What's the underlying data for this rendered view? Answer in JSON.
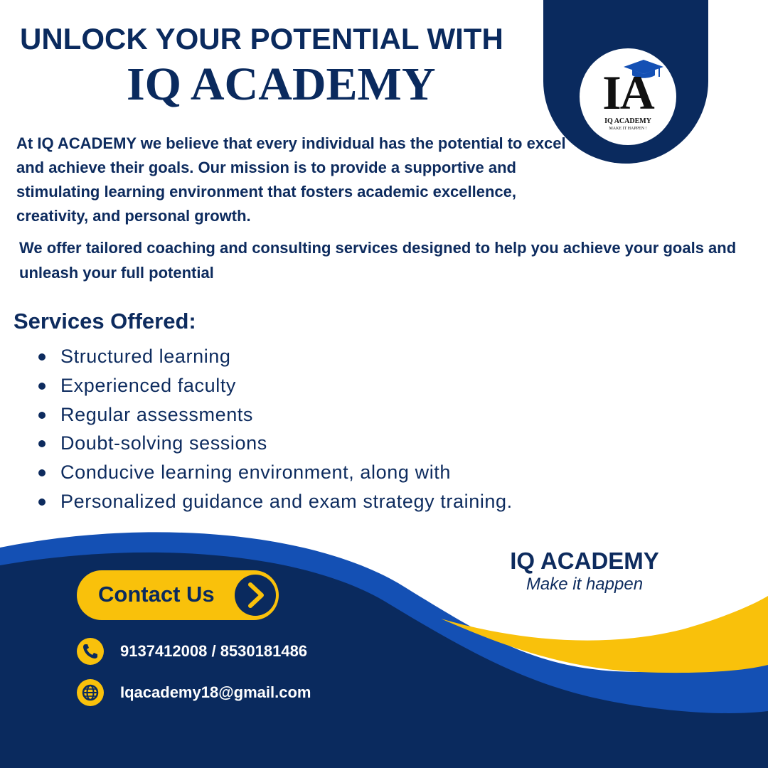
{
  "colors": {
    "navy": "#0a2a5e",
    "royal_blue": "#1450b4",
    "yellow": "#f9c10b",
    "white": "#ffffff"
  },
  "logo": {
    "monogram": "IA",
    "name": "IQ ACADEMY",
    "tagline": "MAKE IT HAPPEN !",
    "icon": "graduation-cap-icon"
  },
  "headline": {
    "line1": "UNLOCK YOUR POTENTIAL WITH",
    "line2": "IQ ACADEMY"
  },
  "intro": "At IQ ACADEMY we believe that every individual has the potential to excel and achieve their goals. Our mission is to provide a supportive and stimulating learning environment that fosters academic excellence, creativity, and personal growth.",
  "offer": "We offer tailored coaching and consulting services designed to help you achieve your goals and unleash your full potential",
  "services": {
    "heading": "Services Offered:",
    "items": [
      "Structured learning",
      "Experienced faculty",
      "Regular assessments",
      "Doubt-solving sessions",
      "Conducive learning environment, along with",
      "Personalized guidance and exam strategy training."
    ]
  },
  "brand": {
    "name": "IQ ACADEMY",
    "tagline": "Make it happen"
  },
  "contact": {
    "button_label": "Contact Us",
    "button_icon": "chevron-right-icon",
    "phone": "9137412008 / 8530181486",
    "phone_icon": "phone-icon",
    "email": "Iqacademy18@gmail.com",
    "email_icon": "globe-icon"
  }
}
